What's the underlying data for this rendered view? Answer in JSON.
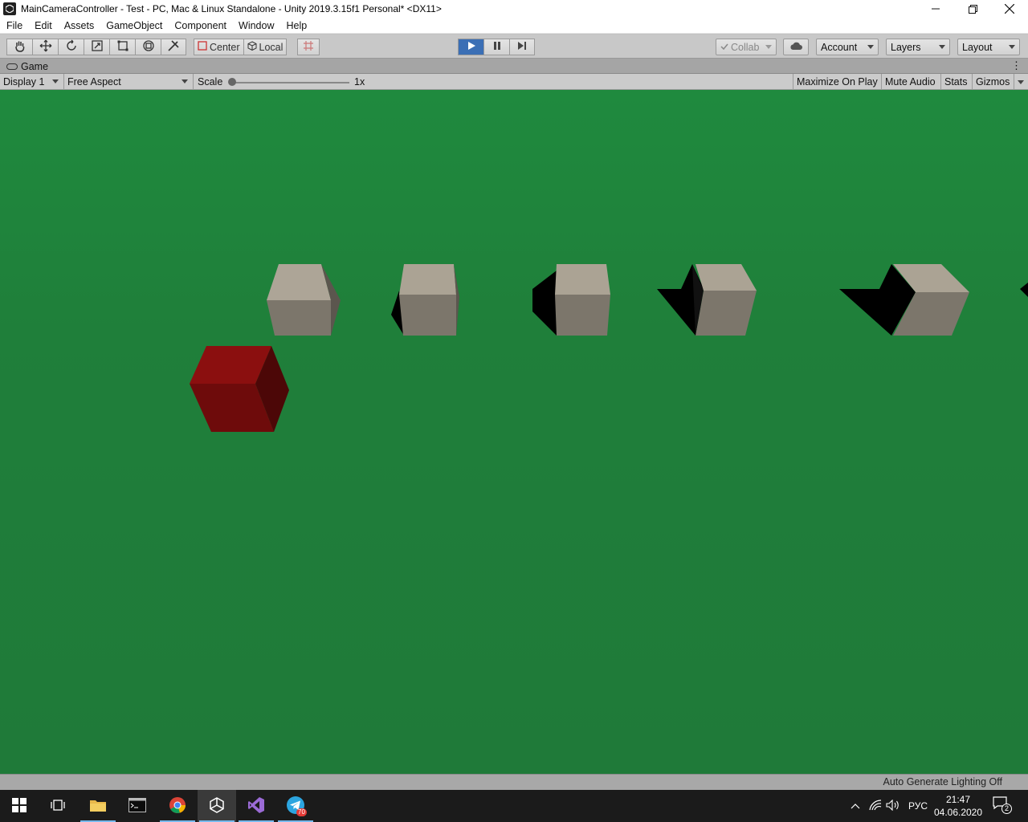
{
  "window": {
    "title": "MainCameraController - Test - PC, Mac & Linux Standalone - Unity 2019.3.15f1 Personal* <DX11>",
    "controls": [
      "minimize",
      "restore",
      "close"
    ]
  },
  "menu": {
    "items": [
      "File",
      "Edit",
      "Assets",
      "GameObject",
      "Component",
      "Window",
      "Help"
    ]
  },
  "toolbar": {
    "tools": [
      "hand-tool",
      "move-tool",
      "rotate-tool",
      "scale-tool",
      "rect-tool",
      "transform-tool",
      "custom-tool"
    ],
    "pivot_label": "Center",
    "space_label": "Local",
    "collab_label": "Collab",
    "account_label": "Account",
    "layers_label": "Layers",
    "layout_label": "Layout",
    "playing": true
  },
  "tab": {
    "label": "Game"
  },
  "gamebar": {
    "display": "Display 1",
    "aspect": "Free Aspect",
    "scale_label": "Scale",
    "scale_value": "1x",
    "scale_fraction": 0.0,
    "maximize_on_play": "Maximize On Play",
    "mute_audio": "Mute Audio",
    "stats": "Stats",
    "gizmos": "Gizmos"
  },
  "scene": {
    "ground_color": "#1f7f3a",
    "cube_color": "#a9a192",
    "player_cube_color": "#7a1010"
  },
  "status": {
    "text": "Auto Generate Lighting Off"
  },
  "taskbar": {
    "apps": [
      "windows-start",
      "task-view",
      "file-explorer",
      "terminal",
      "chrome",
      "unity",
      "visual-studio",
      "telegram"
    ],
    "telegram_badge": "70",
    "language": "РУС",
    "time": "21:47",
    "date": "04.06.2020",
    "notifications": "2"
  }
}
